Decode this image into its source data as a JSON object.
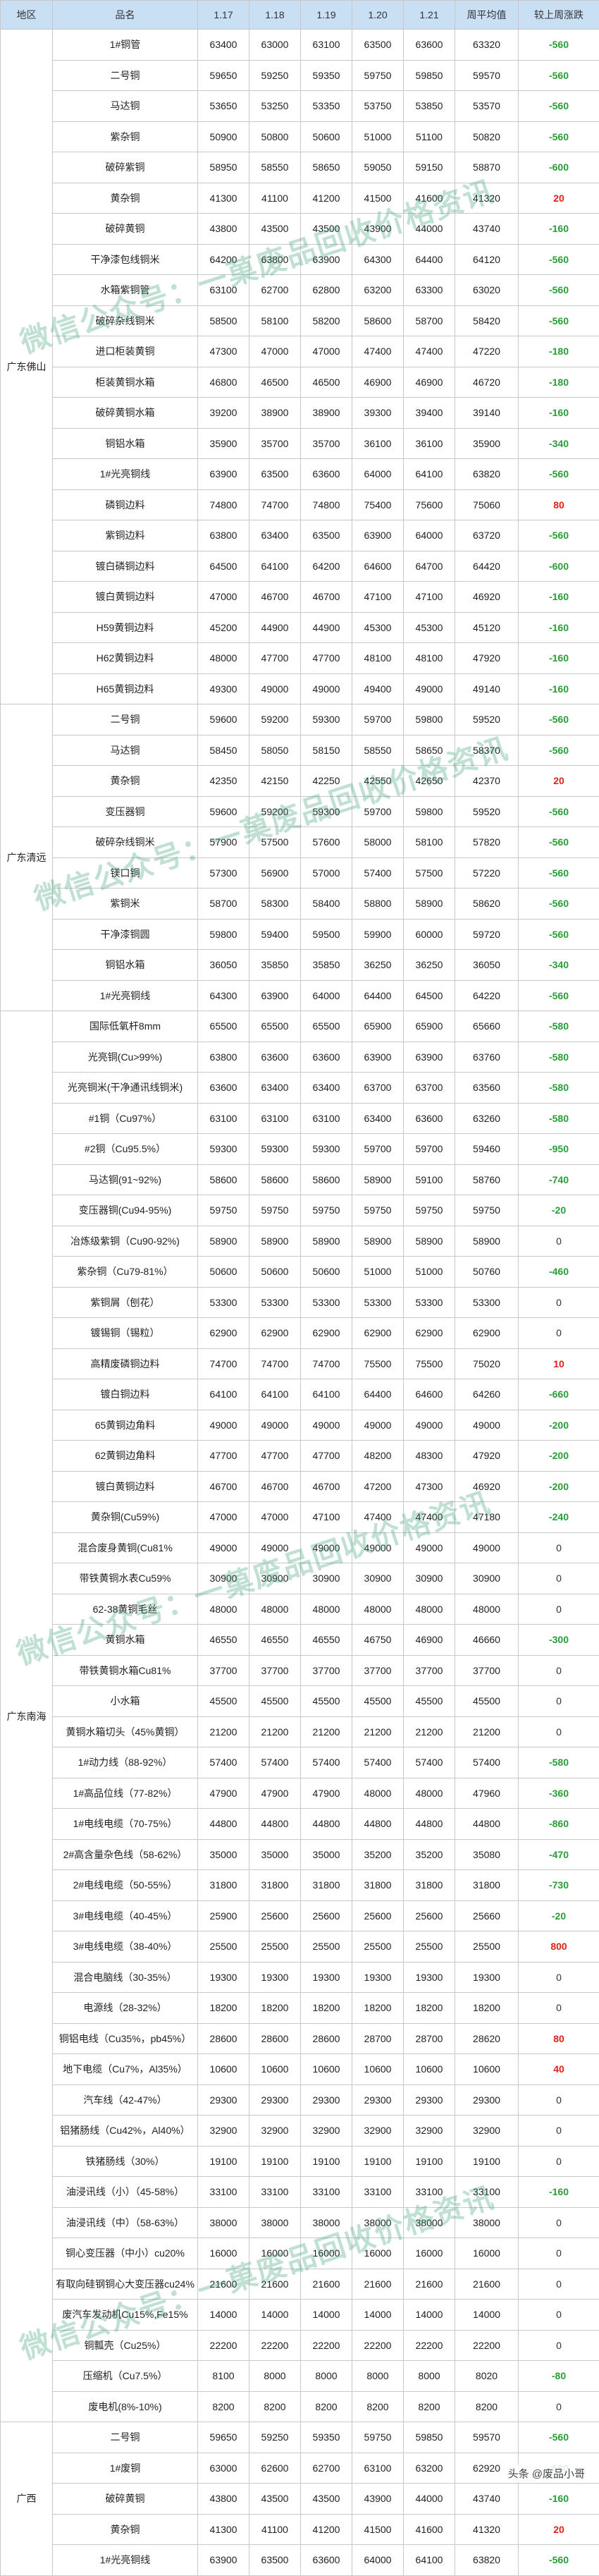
{
  "headers": [
    "地区",
    "品名",
    "1.17",
    "1.18",
    "1.19",
    "1.20",
    "1.21",
    "周平均值",
    "较上周涨跌"
  ],
  "watermark": "微信公众号：一菓废品回收价格资讯",
  "footer": "头条 @废品小哥",
  "colors": {
    "up": "#e0211b",
    "down": "#2a9c38",
    "header_bg": "#c9dff3",
    "watermark": "#3ca078"
  },
  "regions": [
    {
      "name": "广东佛山",
      "rows": [
        {
          "name": "1#铜管",
          "v": [
            "63400",
            "63000",
            "63100",
            "63500",
            "63600",
            "63320"
          ],
          "chg": "-560"
        },
        {
          "name": "二号铜",
          "v": [
            "59650",
            "59250",
            "59350",
            "59750",
            "59850",
            "59570"
          ],
          "chg": "-560"
        },
        {
          "name": "马达铜",
          "v": [
            "53650",
            "53250",
            "53350",
            "53750",
            "53850",
            "53570"
          ],
          "chg": "-560"
        },
        {
          "name": "紫杂铜",
          "v": [
            "50900",
            "50800",
            "50600",
            "51000",
            "51100",
            "50820"
          ],
          "chg": "-560"
        },
        {
          "name": "破碎紫铜",
          "v": [
            "58950",
            "58550",
            "58650",
            "59050",
            "59150",
            "58870"
          ],
          "chg": "-600"
        },
        {
          "name": "黄杂铜",
          "v": [
            "41300",
            "41100",
            "41200",
            "41500",
            "41600",
            "41320"
          ],
          "chg": "20"
        },
        {
          "name": "破碎黄铜",
          "v": [
            "43800",
            "43500",
            "43500",
            "43900",
            "44000",
            "43740"
          ],
          "chg": "-160"
        },
        {
          "name": "干净漆包线铜米",
          "v": [
            "64200",
            "63800",
            "63900",
            "64300",
            "64400",
            "64120"
          ],
          "chg": "-560"
        },
        {
          "name": "水箱紫铜管",
          "v": [
            "63100",
            "62700",
            "62800",
            "63200",
            "63300",
            "63020"
          ],
          "chg": "-560"
        },
        {
          "name": "破碎杂线铜米",
          "v": [
            "58500",
            "58100",
            "58200",
            "58600",
            "58700",
            "58420"
          ],
          "chg": "-560"
        },
        {
          "name": "进口柜装黄铜",
          "v": [
            "47300",
            "47000",
            "47000",
            "47400",
            "47400",
            "47220"
          ],
          "chg": "-180"
        },
        {
          "name": "柜装黄铜水箱",
          "v": [
            "46800",
            "46500",
            "46500",
            "46900",
            "46900",
            "46720"
          ],
          "chg": "-180"
        },
        {
          "name": "破碎黄铜水箱",
          "v": [
            "39200",
            "38900",
            "38900",
            "39300",
            "39400",
            "39140"
          ],
          "chg": "-160"
        },
        {
          "name": "铜铝水箱",
          "v": [
            "35900",
            "35700",
            "35700",
            "36100",
            "36100",
            "35900"
          ],
          "chg": "-340"
        },
        {
          "name": "1#光亮铜线",
          "v": [
            "63900",
            "63500",
            "63600",
            "64000",
            "64100",
            "63820"
          ],
          "chg": "-560"
        },
        {
          "name": "磷铜边料",
          "v": [
            "74800",
            "74700",
            "74800",
            "75400",
            "75600",
            "75060"
          ],
          "chg": "80"
        },
        {
          "name": "紫铜边料",
          "v": [
            "63800",
            "63400",
            "63500",
            "63900",
            "64000",
            "63720"
          ],
          "chg": "-560"
        },
        {
          "name": "镀白磷铜边料",
          "v": [
            "64500",
            "64100",
            "64200",
            "64600",
            "64700",
            "64420"
          ],
          "chg": "-600"
        },
        {
          "name": "镀白黄铜边料",
          "v": [
            "47000",
            "46700",
            "46700",
            "47100",
            "47100",
            "46920"
          ],
          "chg": "-160"
        },
        {
          "name": "H59黄铜边料",
          "v": [
            "45200",
            "44900",
            "44900",
            "45300",
            "45300",
            "45120"
          ],
          "chg": "-160"
        },
        {
          "name": "H62黄铜边料",
          "v": [
            "48000",
            "47700",
            "47700",
            "48100",
            "48100",
            "47920"
          ],
          "chg": "-160"
        },
        {
          "name": "H65黄铜边料",
          "v": [
            "49300",
            "49000",
            "49000",
            "49400",
            "49000",
            "49140"
          ],
          "chg": "-160"
        }
      ]
    },
    {
      "name": "广东清远",
      "rows": [
        {
          "name": "二号铜",
          "v": [
            "59600",
            "59200",
            "59300",
            "59700",
            "59800",
            "59520"
          ],
          "chg": "-560"
        },
        {
          "name": "马达铜",
          "v": [
            "58450",
            "58050",
            "58150",
            "58550",
            "58650",
            "58370"
          ],
          "chg": "-560"
        },
        {
          "name": "黄杂铜",
          "v": [
            "42350",
            "42150",
            "42250",
            "42550",
            "42650",
            "42370"
          ],
          "chg": "20"
        },
        {
          "name": "变压器铜",
          "v": [
            "59600",
            "59200",
            "59300",
            "59700",
            "59800",
            "59520"
          ],
          "chg": "-560"
        },
        {
          "name": "破碎杂线铜米",
          "v": [
            "57900",
            "57500",
            "57600",
            "58000",
            "58100",
            "57820"
          ],
          "chg": "-560"
        },
        {
          "name": "镁口铜",
          "v": [
            "57300",
            "56900",
            "57000",
            "57400",
            "57500",
            "57220"
          ],
          "chg": "-560"
        },
        {
          "name": "紫铜米",
          "v": [
            "58700",
            "58300",
            "58400",
            "58800",
            "58900",
            "58620"
          ],
          "chg": "-560"
        },
        {
          "name": "干净漆铜圆",
          "v": [
            "59800",
            "59400",
            "59500",
            "59900",
            "60000",
            "59720"
          ],
          "chg": "-560"
        },
        {
          "name": "铜铝水箱",
          "v": [
            "36050",
            "35850",
            "35850",
            "36250",
            "36250",
            "36050"
          ],
          "chg": "-340"
        },
        {
          "name": "1#光亮铜线",
          "v": [
            "64300",
            "63900",
            "64000",
            "64400",
            "64500",
            "64220"
          ],
          "chg": "-560"
        }
      ]
    },
    {
      "name": "广东南海",
      "rows": [
        {
          "name": "国际低氧杆8mm",
          "v": [
            "65500",
            "65500",
            "65500",
            "65900",
            "65900",
            "65660"
          ],
          "chg": "-580"
        },
        {
          "name": "光亮铜(Cu>99%)",
          "v": [
            "63800",
            "63600",
            "63600",
            "63900",
            "63900",
            "63760"
          ],
          "chg": "-580"
        },
        {
          "name": "光亮铜米(干净通讯线铜米)",
          "v": [
            "63600",
            "63400",
            "63400",
            "63700",
            "63700",
            "63560"
          ],
          "chg": "-580"
        },
        {
          "name": "#1铜（Cu97%）",
          "v": [
            "63100",
            "63100",
            "63100",
            "63400",
            "63600",
            "63260"
          ],
          "chg": "-580"
        },
        {
          "name": "#2铜（Cu95.5%）",
          "v": [
            "59300",
            "59300",
            "59300",
            "59700",
            "59700",
            "59460"
          ],
          "chg": "-950"
        },
        {
          "name": "马达铜(91~92%)",
          "v": [
            "58600",
            "58600",
            "58600",
            "58900",
            "59100",
            "58760"
          ],
          "chg": "-740"
        },
        {
          "name": "变压器铜(Cu94-95%)",
          "v": [
            "59750",
            "59750",
            "59750",
            "59750",
            "59750",
            "59750"
          ],
          "chg": "-20"
        },
        {
          "name": "冶炼级紫铜（Cu90-92%)",
          "v": [
            "58900",
            "58900",
            "58900",
            "58900",
            "58900",
            "58900"
          ],
          "chg": "0"
        },
        {
          "name": "紫杂铜（Cu79-81%）",
          "v": [
            "50600",
            "50600",
            "50600",
            "51000",
            "51000",
            "50760"
          ],
          "chg": "-460"
        },
        {
          "name": "紫铜屑（刨花）",
          "v": [
            "53300",
            "53300",
            "53300",
            "53300",
            "53300",
            "53300"
          ],
          "chg": "0"
        },
        {
          "name": "镀锡铜（锡粒）",
          "v": [
            "62900",
            "62900",
            "62900",
            "62900",
            "62900",
            "62900"
          ],
          "chg": "0"
        },
        {
          "name": "高精废磷铜边料",
          "v": [
            "74700",
            "74700",
            "74700",
            "75500",
            "75500",
            "75020"
          ],
          "chg": "10"
        },
        {
          "name": "镀白铜边料",
          "v": [
            "64100",
            "64100",
            "64100",
            "64400",
            "64600",
            "64260"
          ],
          "chg": "-660"
        },
        {
          "name": "65黄铜边角料",
          "v": [
            "49000",
            "49000",
            "49000",
            "49000",
            "49000",
            "49000"
          ],
          "chg": "-200"
        },
        {
          "name": "62黄铜边角料",
          "v": [
            "47700",
            "47700",
            "47700",
            "48200",
            "48300",
            "47920"
          ],
          "chg": "-200"
        },
        {
          "name": "镀白黄铜边料",
          "v": [
            "46700",
            "46700",
            "46700",
            "47200",
            "47300",
            "46920"
          ],
          "chg": "-200"
        },
        {
          "name": "黄杂铜(Cu59%)",
          "v": [
            "47000",
            "47000",
            "47100",
            "47400",
            "47400",
            "47180"
          ],
          "chg": "-240"
        },
        {
          "name": "混合废身黄铜(Cu81%",
          "v": [
            "49000",
            "49000",
            "49000",
            "49000",
            "49000",
            "49000"
          ],
          "chg": "0"
        },
        {
          "name": "带铁黄铜水表Cu59%",
          "v": [
            "30900",
            "30900",
            "30900",
            "30900",
            "30900",
            "30900"
          ],
          "chg": "0"
        },
        {
          "name": "62-38黄铜毛丝",
          "v": [
            "48000",
            "48000",
            "48000",
            "48000",
            "48000",
            "48000"
          ],
          "chg": "0"
        },
        {
          "name": "黄铜水箱",
          "v": [
            "46550",
            "46550",
            "46550",
            "46750",
            "46900",
            "46660"
          ],
          "chg": "-300"
        },
        {
          "name": "带铁黄铜水箱Cu81%",
          "v": [
            "37700",
            "37700",
            "37700",
            "37700",
            "37700",
            "37700"
          ],
          "chg": "0"
        },
        {
          "name": "小水箱",
          "v": [
            "45500",
            "45500",
            "45500",
            "45500",
            "45500",
            "45500"
          ],
          "chg": "0"
        },
        {
          "name": "黄铜水箱切头（45%黄铜）",
          "v": [
            "21200",
            "21200",
            "21200",
            "21200",
            "21200",
            "21200"
          ],
          "chg": "0"
        },
        {
          "name": "1#动力线（88-92%）",
          "v": [
            "57400",
            "57400",
            "57400",
            "57400",
            "57400",
            "57400"
          ],
          "chg": "-580"
        },
        {
          "name": "1#高品位线（77-82%）",
          "v": [
            "47900",
            "47900",
            "47900",
            "48000",
            "48000",
            "47960"
          ],
          "chg": "-360"
        },
        {
          "name": "1#电线电缆（70-75%）",
          "v": [
            "44800",
            "44800",
            "44800",
            "44800",
            "44800",
            "44800"
          ],
          "chg": "-860"
        },
        {
          "name": "2#高含量杂色线（58-62%）",
          "v": [
            "35000",
            "35000",
            "35000",
            "35200",
            "35200",
            "35080"
          ],
          "chg": "-470"
        },
        {
          "name": "2#电线电缆（50-55%）",
          "v": [
            "31800",
            "31800",
            "31800",
            "31800",
            "31800",
            "31800"
          ],
          "chg": "-730"
        },
        {
          "name": "3#电线电缆（40-45%）",
          "v": [
            "25900",
            "25600",
            "25600",
            "25600",
            "25600",
            "25660"
          ],
          "chg": "-20"
        },
        {
          "name": "3#电线电缆（38-40%）",
          "v": [
            "25500",
            "25500",
            "25500",
            "25500",
            "25500",
            "25500"
          ],
          "chg": "800"
        },
        {
          "name": "混合电脑线（30-35%）",
          "v": [
            "19300",
            "19300",
            "19300",
            "19300",
            "19300",
            "19300"
          ],
          "chg": "0"
        },
        {
          "name": "电源线（28-32%）",
          "v": [
            "18200",
            "18200",
            "18200",
            "18200",
            "18200",
            "18200"
          ],
          "chg": "0"
        },
        {
          "name": "铜铝电线（Cu35%，pb45%）",
          "v": [
            "28600",
            "28600",
            "28600",
            "28700",
            "28700",
            "28620"
          ],
          "chg": "80"
        },
        {
          "name": "地下电缆（Cu7%，Al35%）",
          "v": [
            "10600",
            "10600",
            "10600",
            "10600",
            "10600",
            "10600"
          ],
          "chg": "40"
        },
        {
          "name": "汽车线（42-47%）",
          "v": [
            "29300",
            "29300",
            "29300",
            "29300",
            "29300",
            "29300"
          ],
          "chg": "0"
        },
        {
          "name": "铝猪肠线（Cu42%，Al40%）",
          "v": [
            "32900",
            "32900",
            "32900",
            "32900",
            "32900",
            "32900"
          ],
          "chg": "0"
        },
        {
          "name": "铁猪肠线（30%）",
          "v": [
            "19100",
            "19100",
            "19100",
            "19100",
            "19100",
            "19100"
          ],
          "chg": "0"
        },
        {
          "name": "油浸讯线（小）（45-58%）",
          "v": [
            "33100",
            "33100",
            "33100",
            "33100",
            "33100",
            "33100"
          ],
          "chg": "-160"
        },
        {
          "name": "油浸讯线（中）（58-63%）",
          "v": [
            "38000",
            "38000",
            "38000",
            "38000",
            "38000",
            "38000"
          ],
          "chg": "0"
        },
        {
          "name": "铜心变压器（中小）cu20%",
          "v": [
            "16000",
            "16000",
            "16000",
            "16000",
            "16000",
            "16000"
          ],
          "chg": "0"
        },
        {
          "name": "有取向硅钢铜心大变压器cu24%",
          "v": [
            "21600",
            "21600",
            "21600",
            "21600",
            "21600",
            "21600"
          ],
          "chg": "0"
        },
        {
          "name": "废汽车发动机Cu15%,Fe15%",
          "v": [
            "14000",
            "14000",
            "14000",
            "14000",
            "14000",
            "14000"
          ],
          "chg": "0"
        },
        {
          "name": "铜瓢壳（Cu25%）",
          "v": [
            "22200",
            "22200",
            "22200",
            "22200",
            "22200",
            "22200"
          ],
          "chg": "0"
        },
        {
          "name": "压缩机（Cu7.5%）",
          "v": [
            "8100",
            "8000",
            "8000",
            "8000",
            "8000",
            "8020"
          ],
          "chg": "-80"
        },
        {
          "name": "废电机(8%-10%)",
          "v": [
            "8200",
            "8200",
            "8200",
            "8200",
            "8200",
            "8200"
          ],
          "chg": "0"
        }
      ]
    },
    {
      "name": "广西",
      "rows": [
        {
          "name": "二号铜",
          "v": [
            "59650",
            "59250",
            "59350",
            "59750",
            "59850",
            "59570"
          ],
          "chg": "-560"
        },
        {
          "name": "1#废铜",
          "v": [
            "63000",
            "62600",
            "62700",
            "63100",
            "63200",
            "62920"
          ],
          "chg": "-580"
        },
        {
          "name": "破碎黄铜",
          "v": [
            "43800",
            "43500",
            "43500",
            "43900",
            "44000",
            "43740"
          ],
          "chg": "-160"
        },
        {
          "name": "黄杂铜",
          "v": [
            "41300",
            "41100",
            "41200",
            "41500",
            "41600",
            "41320"
          ],
          "chg": "20"
        },
        {
          "name": "1#光亮铜线",
          "v": [
            "63900",
            "63500",
            "63600",
            "64000",
            "64100",
            "63820"
          ],
          "chg": "-560"
        }
      ]
    }
  ]
}
